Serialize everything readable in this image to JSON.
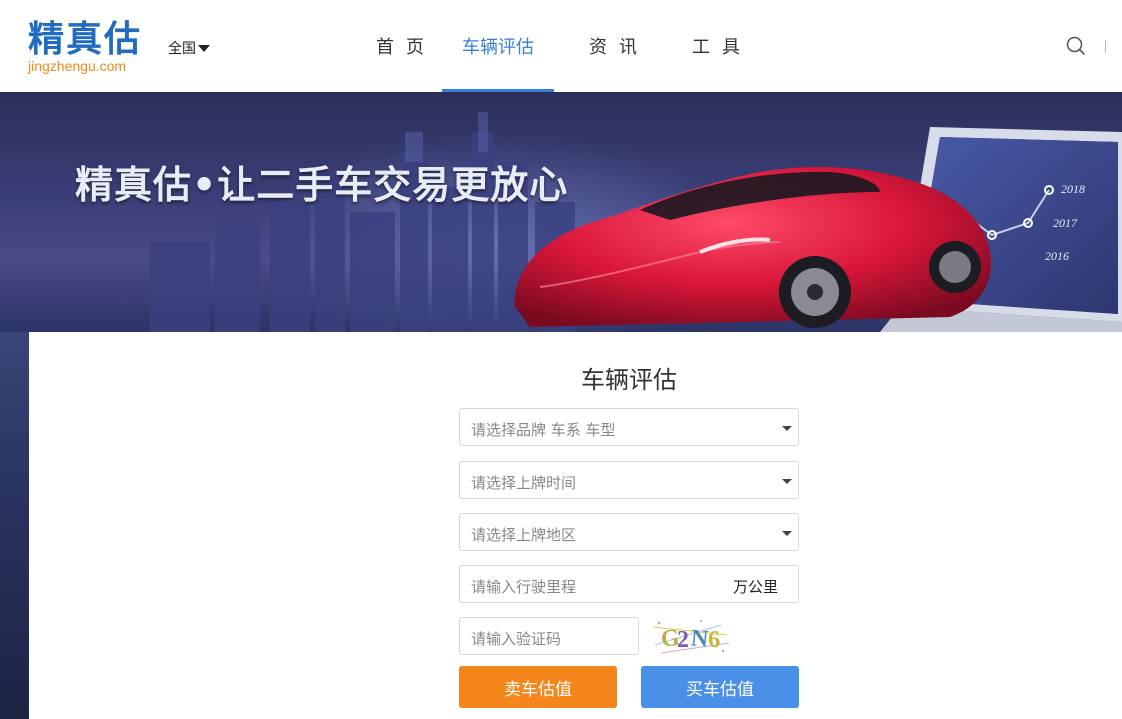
{
  "header": {
    "logo": {
      "cn": "精真估",
      "en": "jingzhengu.com"
    },
    "region": "全国",
    "nav": [
      "首页",
      "车辆评估",
      "资讯",
      "工具"
    ],
    "active_nav": "车辆评估"
  },
  "banner": {
    "slogan": "精真估•让二手车交易更放心",
    "years": [
      "2018",
      "2017",
      "2016"
    ]
  },
  "form": {
    "title": "车辆评估",
    "brand_placeholder": "请选择品牌 车系 车型",
    "date_placeholder": "请选择上牌时间",
    "region_placeholder": "请选择上牌地区",
    "mileage_placeholder": "请输入行驶里程",
    "mileage_unit": "万公里",
    "captcha_placeholder": "请输入验证码",
    "captcha_code": "G2N6",
    "sell_button": "卖车估值",
    "buy_button": "买车估值"
  },
  "colors": {
    "brand_blue": "#1f6cc0",
    "accent_blue": "#3a7fd5",
    "orange": "#f4861c",
    "button_blue": "#4a8fe8",
    "car_red": "#d8163a"
  }
}
